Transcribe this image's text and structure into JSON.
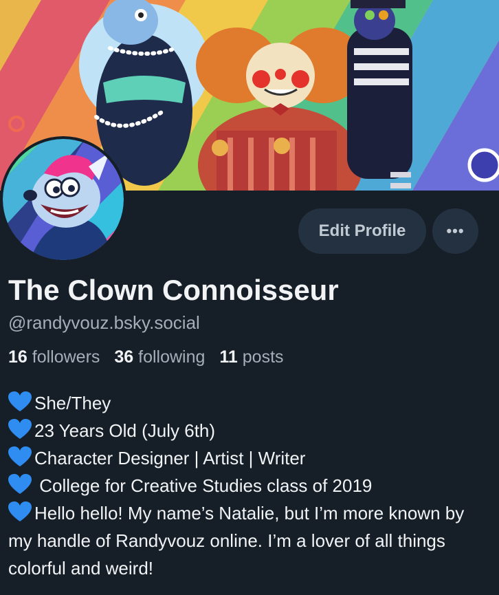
{
  "profile": {
    "display_name": "The Clown Connoisseur",
    "handle": "@randyvouz.bsky.social",
    "edit_button": "Edit Profile",
    "more_button": "•••"
  },
  "stats": {
    "followers_count": "16",
    "followers_label": "followers",
    "following_count": "36",
    "following_label": "following",
    "posts_count": "11",
    "posts_label": "posts"
  },
  "bio": {
    "line_icon": "blue-heart-icon",
    "lines": [
      "She/They",
      "23 Years Old (July 6th)",
      "Character Designer | Artist | Writer",
      " College for Creative Studies class of 2019",
      "Hello hello! My name’s Natalie, but I’m more known by my handle of Randyvouz online. I’m a lover of all things colorful and weird!"
    ]
  },
  "colors": {
    "background": "#161e27",
    "button_bg": "#243140",
    "muted_text": "#a4afba",
    "heart_blue": "#2f8cf0"
  }
}
